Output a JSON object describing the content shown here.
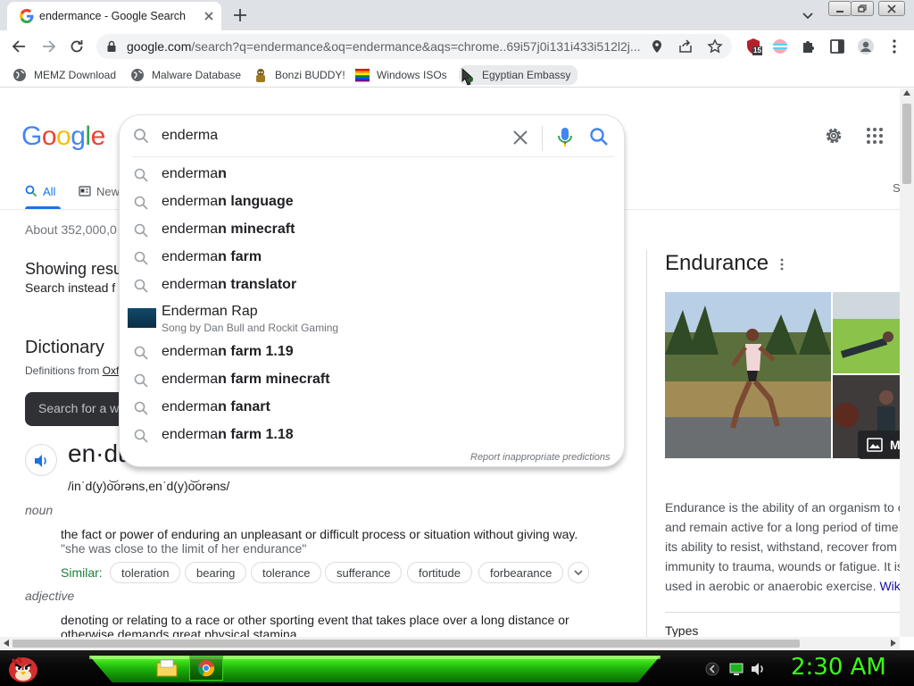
{
  "tab": {
    "title": "endermance - Google Search"
  },
  "toolbar": {
    "url_host": "google.com",
    "url_path": "/search?q=endermance&oq=endermance&aqs=chrome..69i57j0i131i433i512l2j...",
    "extension_badge": "15"
  },
  "bookmarks": [
    {
      "label": "MEMZ Download",
      "icon": "globe-icon"
    },
    {
      "label": "Malware Database",
      "icon": "globe-icon"
    },
    {
      "label": "Bonzi BUDDY!",
      "icon": "bonzi-icon"
    },
    {
      "label": "Windows ISOs",
      "icon": "rainbow-flag-icon"
    },
    {
      "label": "Egyptian Embassy",
      "icon": "cursor-icon"
    }
  ],
  "search": {
    "query": "enderma",
    "report": "Report inappropriate predictions",
    "suggestions": [
      {
        "prefix": "enderma",
        "bold": "n"
      },
      {
        "prefix": "enderma",
        "bold": "n language"
      },
      {
        "prefix": "enderma",
        "bold": "n minecraft"
      },
      {
        "prefix": "enderma",
        "bold": "n farm"
      },
      {
        "prefix": "enderma",
        "bold": "n translator"
      },
      {
        "prefix": "enderma",
        "bold": "n farm 1.19"
      },
      {
        "prefix": "enderma",
        "bold": "n farm minecraft"
      },
      {
        "prefix": "enderma",
        "bold": "n fanart"
      },
      {
        "prefix": "enderma",
        "bold": "n farm 1.18"
      }
    ],
    "rich_suggestion": {
      "title": "Enderman Rap",
      "subtitle": "Song by Dan Bull and Rockit Gaming"
    }
  },
  "results": {
    "tab_all": "All",
    "tab_news": "New",
    "tab_right": "S",
    "stats": "About 352,000,0",
    "showing": "Showing resu",
    "instead": "Search instead f",
    "dictionary": "Dictionary",
    "defs_from_prefix": "Definitions from ",
    "defs_from_link": "Oxf",
    "dict_search_placeholder": "Search for a w",
    "headword": "en·du",
    "pronunciation": "/inˈd(y)o͝orəns,enˈd(y)o͝orəns/",
    "noun": "noun",
    "def1": "the fact or power of enduring an unpleasant or difficult process or situation without giving way.",
    "ex1": "\"she was close to the limit of her endurance\"",
    "similar_label": "Similar:",
    "similar": [
      "toleration",
      "bearing",
      "tolerance",
      "sufferance",
      "fortitude",
      "forbearance"
    ],
    "adjective": "adjective",
    "def2": "denoting or relating to a race or other sporting event that takes place over a long distance or",
    "def2b": "otherwise demands great physical stamina"
  },
  "knowledge_panel": {
    "title": "Endurance",
    "more_images": "M",
    "desc_lines": [
      "Endurance is the ability of an organism to e",
      "and remain active for a long period of time,",
      "its ability to resist, withstand, recover from",
      "immunity to trauma, wounds or fatigue. It is"
    ],
    "desc_last": "used in aerobic or anaerobic exercise. ",
    "wiki": "Wiki",
    "types": "Types"
  },
  "taskbar": {
    "clock": "2:30 AM"
  },
  "colors": {
    "accent": "#1a73e8",
    "clock": "#39ff14",
    "taskbar_glow": "#1fb80b"
  }
}
